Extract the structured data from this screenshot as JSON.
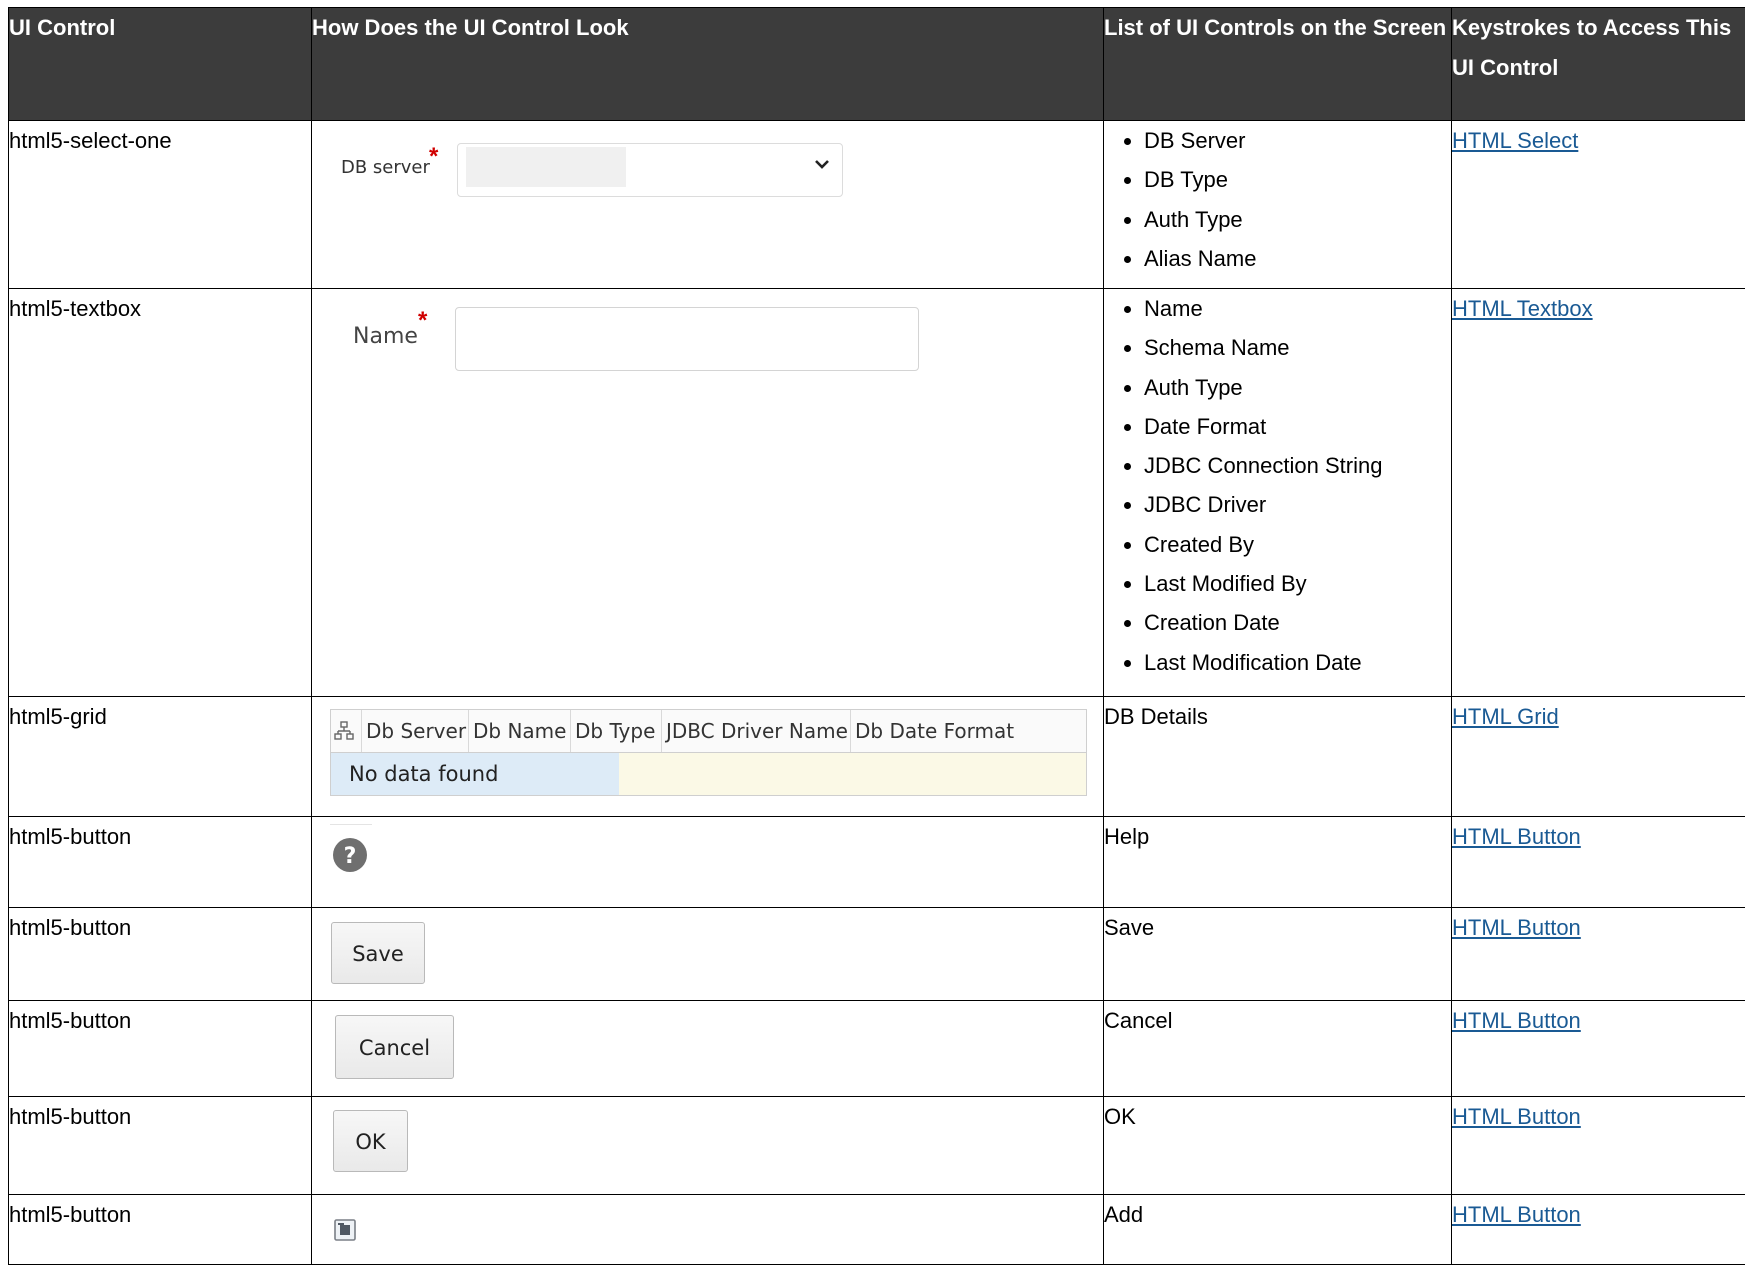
{
  "headers": {
    "ui_control": "UI Control",
    "look": "How Does the UI Control Look",
    "list": "List of UI Controls on the Screen",
    "keys": "Keystrokes to Access This UI Control"
  },
  "rows": [
    {
      "control": "html5-select-one",
      "list": [
        "DB Server",
        "DB Type",
        "Auth Type",
        "Alias Name"
      ],
      "link": "HTML Select"
    },
    {
      "control": "html5-textbox",
      "list": [
        "Name",
        "Schema Name",
        "Auth Type",
        "Date Format",
        "JDBC Connection String",
        "JDBC Driver",
        "Created By",
        "Last Modified By",
        "Creation Date",
        "Last Modification Date"
      ],
      "link": "HTML Textbox"
    },
    {
      "control": "html5-grid",
      "text": "DB Details",
      "link": "HTML Grid"
    },
    {
      "control": "html5-button",
      "text": "Help",
      "link": "HTML Button"
    },
    {
      "control": "html5-button",
      "text": "Save",
      "link": "HTML Button"
    },
    {
      "control": "html5-button",
      "text": "Cancel",
      "link": "HTML Button"
    },
    {
      "control": "html5-button",
      "text": "OK",
      "link": "HTML Button"
    },
    {
      "control": "html5-button",
      "text": "Add",
      "link": "HTML Button"
    }
  ],
  "mock": {
    "select_label": "DB server",
    "required_mark": "*",
    "textbox_label": "Name",
    "grid_columns": [
      "Db Server",
      "Db Name",
      "Db Type",
      "JDBC Driver Name",
      "Db Date Format"
    ],
    "grid_empty": "No data found",
    "save_button": "Save",
    "cancel_button": "Cancel",
    "ok_button": "OK"
  },
  "icons": {
    "grid_header": "hierarchy-icon",
    "help": "help-icon",
    "add": "add-icon",
    "select": "chevron-down-icon"
  },
  "colors": {
    "header_bg": "#3c3c3c",
    "link": "#1a5a94",
    "required": "#d00000"
  }
}
